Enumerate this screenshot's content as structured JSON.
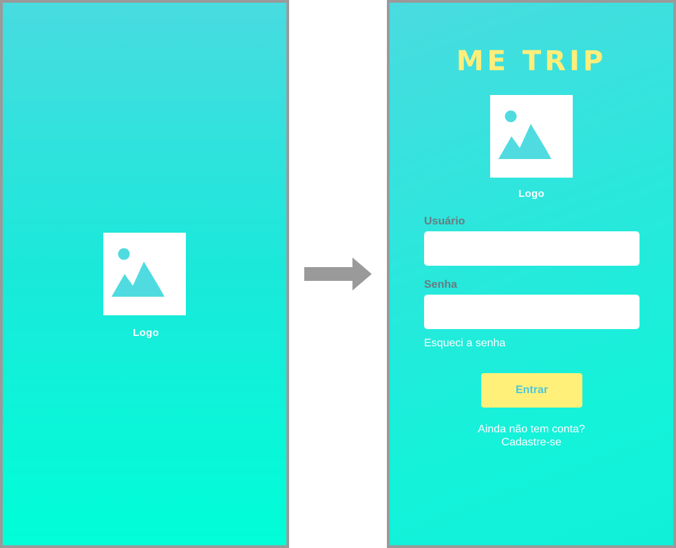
{
  "splash": {
    "logo_icon": "image-placeholder-icon",
    "logo_label": "Logo"
  },
  "login": {
    "title": "ME TRIP",
    "logo_icon": "image-placeholder-icon",
    "logo_label": "Logo",
    "username_label": "Usuário",
    "username_value": "",
    "password_label": "Senha",
    "password_value": "",
    "forgot_link": "Esqueci a senha",
    "enter_button": "Entrar",
    "signup_line1": "Ainda não tem conta?",
    "signup_line2": "Cadastre-se"
  },
  "transition_icon": "arrow-right-icon",
  "colors": {
    "title": "#ffee7a",
    "button_bg": "#fff07a",
    "button_text": "#4ec6d9",
    "icon": "#4fdbe0",
    "frame_border": "#9a9a9a"
  }
}
